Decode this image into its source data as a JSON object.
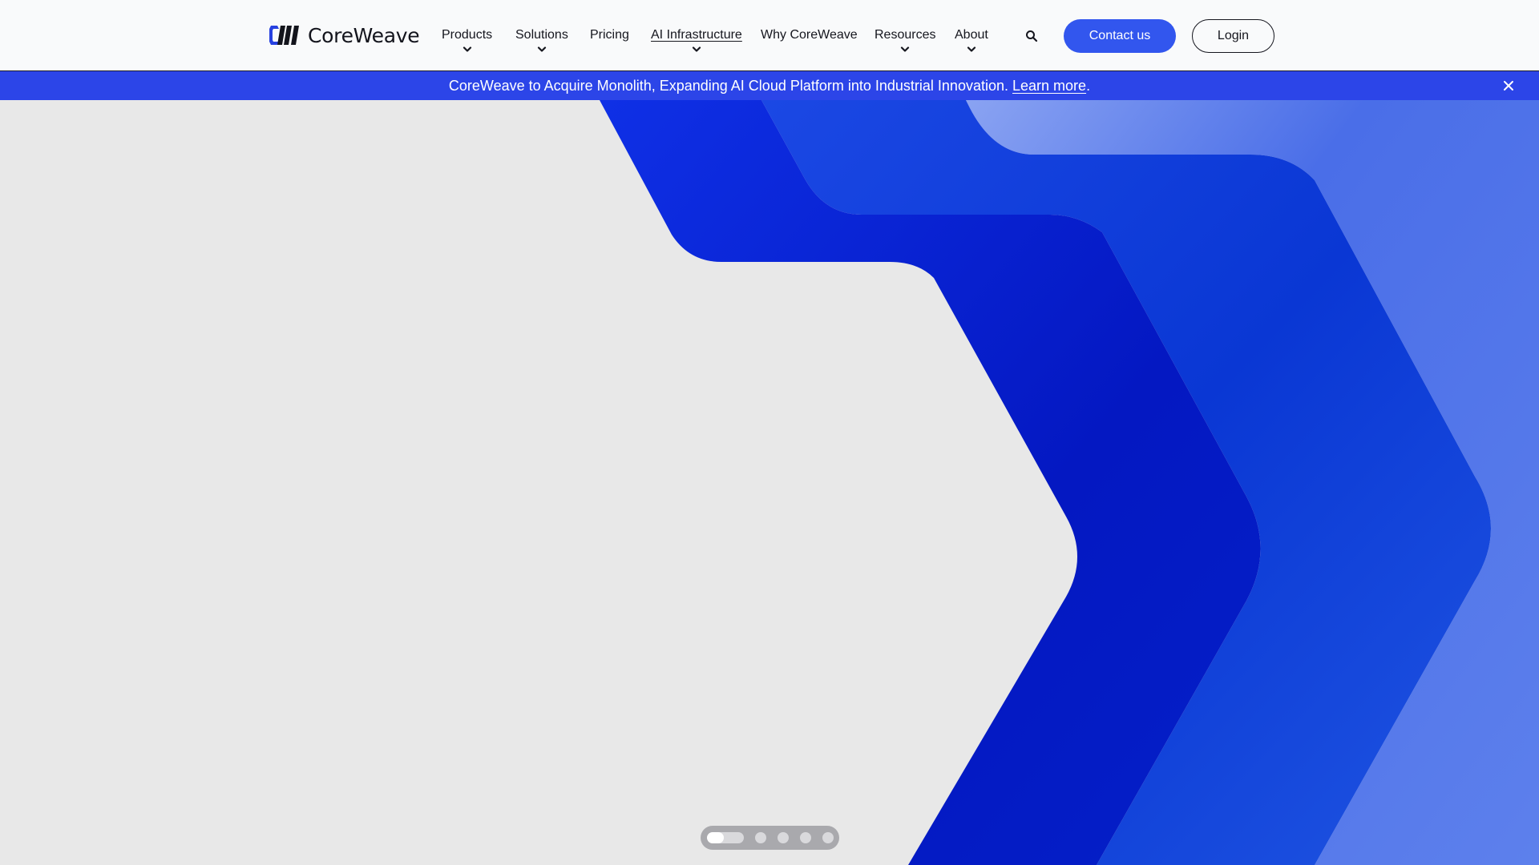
{
  "brand": {
    "name": "CoreWeave",
    "logo_color": "#2741e0"
  },
  "nav": {
    "items": [
      {
        "label": "Products",
        "has_dropdown": true
      },
      {
        "label": "Solutions",
        "has_dropdown": true
      },
      {
        "label": "Pricing",
        "has_dropdown": false
      },
      {
        "label": "AI Infrastructure",
        "has_dropdown": true,
        "active": true
      },
      {
        "label": "Why CoreWeave",
        "has_dropdown": false
      },
      {
        "label": "Resources",
        "has_dropdown": true
      },
      {
        "label": "About",
        "has_dropdown": true
      }
    ],
    "search_icon": "search-icon",
    "contact_label": "Contact us",
    "login_label": "Login"
  },
  "announcement": {
    "text": "CoreWeave to Acquire Monolith, Expanding AI Cloud Platform into Industrial Innovation.",
    "link_label": "Learn more",
    "trailing": ".",
    "close_icon": "close-icon"
  },
  "carousel": {
    "slide_count": 5,
    "active_index": 0,
    "active_progress": 0.45
  },
  "colors": {
    "accent": "#3256ee",
    "banner": "#2c45e8",
    "hero_bg": "#e8e8e8",
    "chevron_dark": "#0522c9",
    "chevron_mid": "#1543dc",
    "chevron_light": "#6f8ff0"
  }
}
